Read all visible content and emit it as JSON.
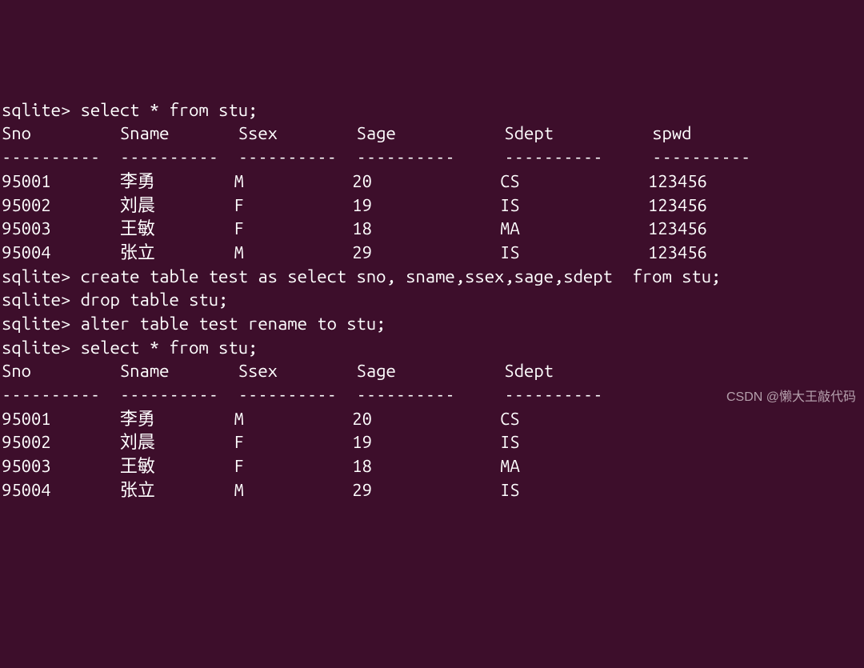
{
  "prompt": "sqlite>",
  "commands": {
    "select_stu_1": "select * from stu;",
    "create_test": "create table test as select sno, sname,ssex,sage,sdept  from stu;",
    "drop_stu": "drop table stu;",
    "rename_test": "alter table test rename to stu;",
    "select_stu_2": "select * from stu;"
  },
  "table1": {
    "headers": [
      "Sno",
      "Sname",
      "Ssex",
      "Sage",
      "Sdept",
      "spwd"
    ],
    "rows": [
      [
        "95001",
        "李勇",
        "M",
        "20",
        "CS",
        "123456"
      ],
      [
        "95002",
        "刘晨",
        "F",
        "19",
        "IS",
        "123456"
      ],
      [
        "95003",
        "王敏",
        "F",
        "18",
        "MA",
        "123456"
      ],
      [
        "95004",
        "张立",
        "M",
        "29",
        "IS",
        "123456"
      ]
    ]
  },
  "table2": {
    "headers": [
      "Sno",
      "Sname",
      "Ssex",
      "Sage",
      "Sdept"
    ],
    "rows": [
      [
        "95001",
        "李勇",
        "M",
        "20",
        "CS"
      ],
      [
        "95002",
        "刘晨",
        "F",
        "19",
        "IS"
      ],
      [
        "95003",
        "王敏",
        "F",
        "18",
        "MA"
      ],
      [
        "95004",
        "张立",
        "M",
        "29",
        "IS"
      ]
    ]
  },
  "separator": "----------",
  "watermark": "CSDN @懒大王敲代码"
}
